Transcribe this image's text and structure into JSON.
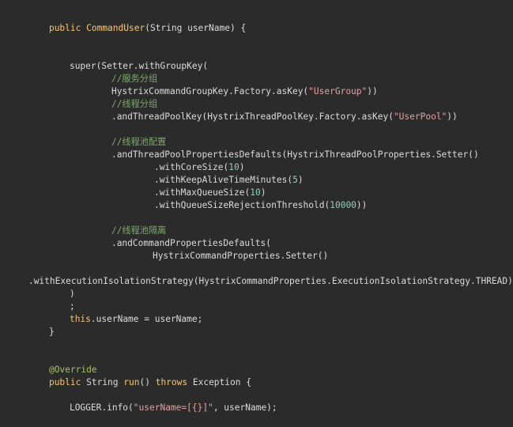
{
  "code": {
    "l1": {
      "kw_public": "public ",
      "name": "CommandUser",
      "rest": "(String userName) {"
    },
    "l2": {
      "text": "super(Setter.withGroupKey("
    },
    "l3": {
      "comment": "//服务分组"
    },
    "l4": {
      "pre": "HystrixCommandGroupKey.Factory.asKey(",
      "str": "\"UserGroup\"",
      "post": "))"
    },
    "l5": {
      "comment": "//线程分组"
    },
    "l6": {
      "pre": ".andThreadPoolKey(HystrixThreadPoolKey.Factory.asKey(",
      "str": "\"UserPool\"",
      "post": "))"
    },
    "l7": {
      "comment": "//线程池配置"
    },
    "l8": {
      "text": ".andThreadPoolPropertiesDefaults(HystrixThreadPoolProperties.Setter()"
    },
    "l9": {
      "pre": ".withCoreSize(",
      "num": "10",
      "post": ")"
    },
    "l10": {
      "pre": ".withKeepAliveTimeMinutes(",
      "num": "5",
      "post": ")"
    },
    "l11": {
      "pre": ".withMaxQueueSize(",
      "num": "10",
      "post": ")"
    },
    "l12": {
      "pre": ".withQueueSizeRejectionThreshold(",
      "num": "10000",
      "post": "))"
    },
    "l13": {
      "comment": "//线程池隔离"
    },
    "l14": {
      "text": ".andCommandPropertiesDefaults("
    },
    "l15": {
      "text": "HystrixCommandProperties.Setter()"
    },
    "l16": {
      "text": ".withExecutionIsolationStrategy(HystrixCommandProperties.ExecutionIsolationStrategy.THREAD))"
    },
    "l17": {
      "text": ")"
    },
    "l18": {
      "text": ";"
    },
    "l19": {
      "kw_this": "this",
      "rest": ".userName = userName;"
    },
    "l20": {
      "text": "}"
    },
    "l21": {
      "annotation": "@Override"
    },
    "l22": {
      "kw_public": "public ",
      "type": "String ",
      "name": "run",
      "mid": "() ",
      "kw_throws": "throws ",
      "rest": "Exception {"
    },
    "l23": {
      "pre": "LOGGER.info(",
      "str": "\"userName=[{}]\"",
      "post": ", userName);"
    }
  }
}
